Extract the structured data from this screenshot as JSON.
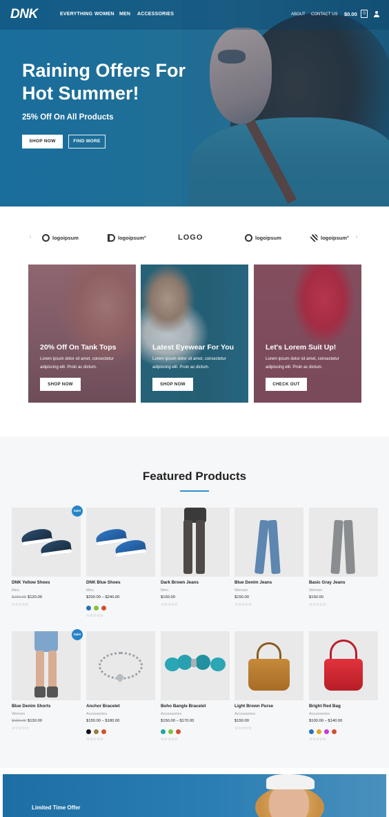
{
  "nav": {
    "logo": "DNK",
    "links": [
      "EVERYTHING",
      "WOMEN",
      "MEN",
      "ACCESSORIES"
    ],
    "right_links": [
      "ABOUT",
      "CONTACT US"
    ],
    "cart_amount": "$0.00",
    "cart_count": "0"
  },
  "hero": {
    "title": "Raining Offers For Hot Summer!",
    "subtitle": "25% Off On All Products",
    "primary_button": "SHOP NOW",
    "secondary_button": "FIND MORE"
  },
  "brands": [
    {
      "label": "logoipsum",
      "icon": "circle-slash-logo-icon"
    },
    {
      "label": "logoipsum°",
      "icon": "half-circle-logo-icon"
    },
    {
      "label": "LOGO",
      "icon": "block-logo-icon"
    },
    {
      "label": "logoipsum",
      "icon": "circle-logo-icon"
    },
    {
      "label": "logoipsum°",
      "icon": "grid-logo-icon"
    }
  ],
  "promos": [
    {
      "title": "20% Off On Tank Tops",
      "text": "Lorem ipsum dolor sit amet, consectetur adipiscing elit. Proin ac dictum.",
      "button": "SHOP NOW"
    },
    {
      "title": "Latest Eyewear For You",
      "text": "Lorem ipsum dolor sit amet, consectetur adipiscing elit. Proin ac dictum.",
      "button": "SHOP NOW"
    },
    {
      "title": "Let's Lorem Suit Up!",
      "text": "Lorem ipsum dolor sit amet, consectetur adipiscing elit. Proin ac dictum.",
      "button": "CHECK OUT"
    }
  ],
  "featured": {
    "title": "Featured Products",
    "sale_badge": "Sale!",
    "stars": "☆☆☆☆☆",
    "products": [
      {
        "name": "DNK Yellow Shoes",
        "category": "Men",
        "old_price": "$150.00",
        "price": "$120.00",
        "sale": true
      },
      {
        "name": "DNK Blue Shoes",
        "category": "Men",
        "price": "$200.00 – $240.00",
        "swatches": [
          "#2a6fc1",
          "#7fc43b",
          "#d2502f"
        ]
      },
      {
        "name": "Dark Brown Jeans",
        "category": "Men",
        "price": "$150.00"
      },
      {
        "name": "Blue Denim Jeans",
        "category": "Women",
        "price": "$150.00"
      },
      {
        "name": "Basic Gray Jeans",
        "category": "Women",
        "price": "$150.00"
      },
      {
        "name": "Blue Denim Shorts",
        "category": "Women",
        "old_price": "$150.00",
        "price": "$130.00",
        "sale": true
      },
      {
        "name": "Anchor Bracelet",
        "category": "Accessories",
        "price": "$150.00 – $180.00",
        "swatches": [
          "#111111",
          "#9a7d3e",
          "#d2502f"
        ]
      },
      {
        "name": "Boho Bangle Bracelet",
        "category": "Accessories",
        "price": "$150.00 – $170.00",
        "swatches": [
          "#22a7a0",
          "#7fc43b",
          "#d2502f"
        ]
      },
      {
        "name": "Light Brown Purse",
        "category": "Accessories",
        "price": "$150.00"
      },
      {
        "name": "Bright Red Bag",
        "category": "Accessories",
        "price": "$100.00 – $140.00",
        "swatches": [
          "#2a6fc1",
          "#e3a425",
          "#c63ad8",
          "#d2502f"
        ]
      }
    ]
  },
  "banner": {
    "text": "Limited Time Offer"
  }
}
